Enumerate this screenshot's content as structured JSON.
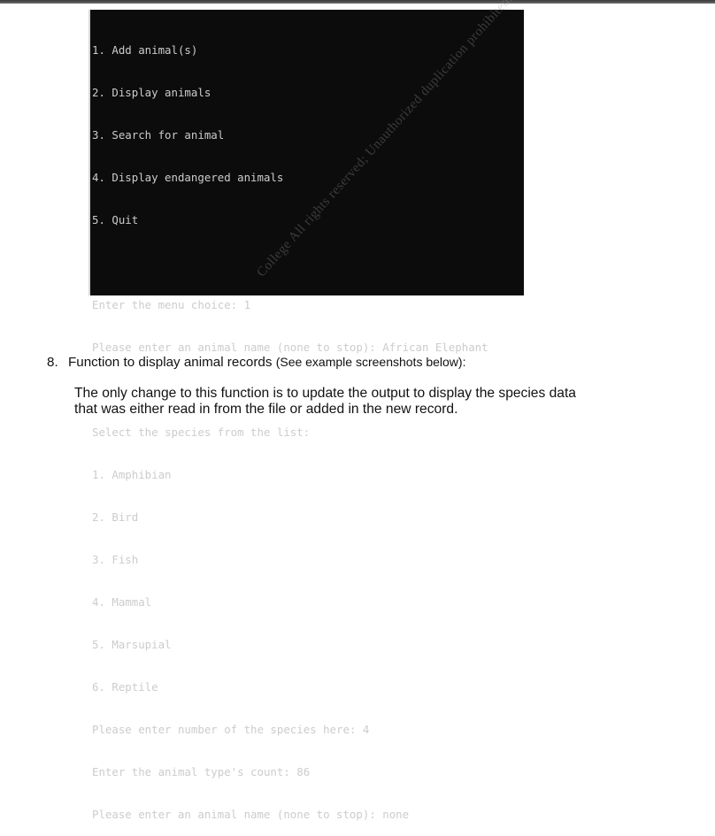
{
  "terminal": {
    "lines": [
      "1. Add animal(s)",
      "2. Display animals",
      "3. Search for animal",
      "4. Display endangered animals",
      "5. Quit",
      "",
      "Enter the menu choice: 1",
      "Please enter an animal name (none to stop): African Elephant",
      "",
      "Select the species from the list:",
      "1. Amphibian",
      "2. Bird",
      "3. Fish",
      "4. Mammal",
      "5. Marsupial",
      "6. Reptile",
      "Please enter number of the species here: 4",
      "Enter the animal type's count: 86",
      "Please enter an animal name (none to stop): none"
    ]
  },
  "document": {
    "item_number": "8.",
    "item_title": "Function to display animal records",
    "item_note": "(See example screenshots below):",
    "paragraph_line1": "The only change to this function is to update the output to display the species data",
    "paragraph_line2": "that was either read in from the file or added in the new record."
  },
  "watermark": {
    "text": "College All rights reserved; Unauthorized duplication prohibited."
  },
  "colors": {
    "terminal_bg": "#0c0c0c",
    "terminal_fg": "#cccccc",
    "doc_text": "#111111"
  }
}
